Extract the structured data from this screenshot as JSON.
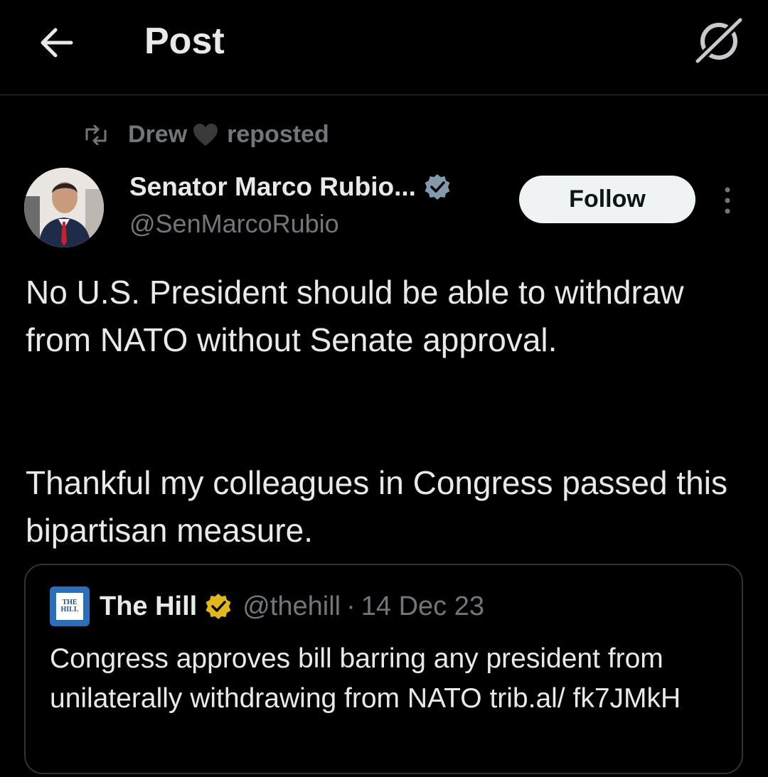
{
  "header": {
    "title": "Post",
    "back_icon": "arrow-left-icon",
    "grok_icon": "grok-icon"
  },
  "repost": {
    "user": "Drew",
    "label": "reposted",
    "heart_color": "#3a3a3a"
  },
  "author": {
    "name": "Senator Marco Rubio...",
    "handle": "@SenMarcoRubio",
    "verified_color": "#829aab",
    "follow_label": "Follow"
  },
  "post": {
    "paragraph1": "No U.S. President should be able to withdraw from NATO without Senate approval.",
    "paragraph2": "Thankful my colleagues in Congress passed this bipartisan measure."
  },
  "quote": {
    "logo_text_1": "THE",
    "logo_text_2": "HILL",
    "name": "The Hill",
    "verified_color": "#e2b719",
    "handle": "@thehill",
    "separator": "·",
    "date": "14 Dec 23",
    "text": "Congress approves bill barring any president from unilaterally withdrawing from NATO trib.al/ fk7JMkH"
  }
}
